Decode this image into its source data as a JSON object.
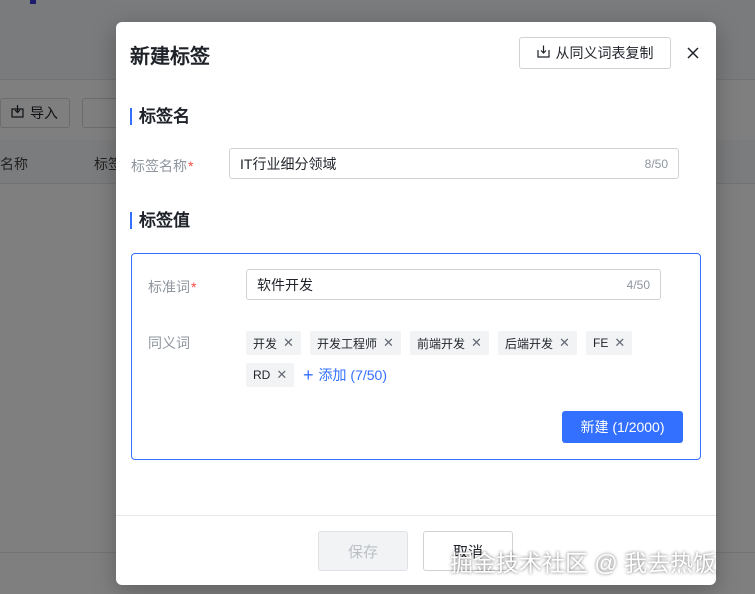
{
  "background": {
    "import_label": "导入",
    "col_name": "名称",
    "col_tag": "标签"
  },
  "modal": {
    "title": "新建标签",
    "copy_button": "从同义词表复制",
    "close_icon": "close-icon",
    "section_name": "标签名",
    "tag_name_label": "标签名称",
    "tag_name_value": "IT行业细分领域",
    "tag_name_count": "8/50",
    "section_value": "标签值",
    "standard_label": "标准词",
    "standard_value": "软件开发",
    "standard_count": "4/50",
    "synonym_label": "同义词",
    "synonyms": [
      "开发",
      "开发工程师",
      "前端开发",
      "后端开发",
      "FE",
      "RD"
    ],
    "add_label": "添加 (7/50)",
    "new_button": "新建 (1/2000)",
    "save_button": "保存",
    "cancel_button": "取消",
    "required_mark": "*"
  },
  "watermark": "掘金技术社区 @ 我去热饭",
  "colors": {
    "accent": "#3370ff",
    "required": "#f54a45"
  }
}
